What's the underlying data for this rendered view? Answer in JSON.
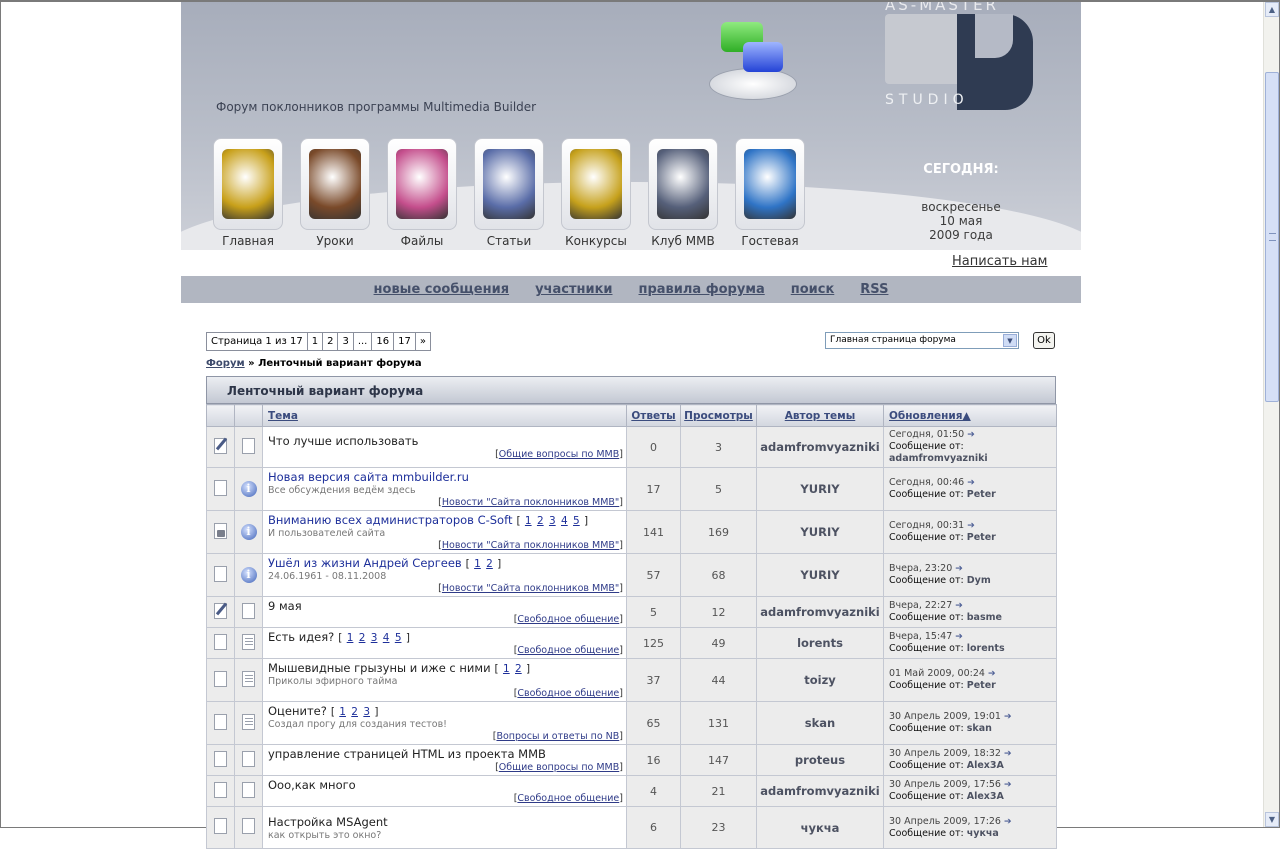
{
  "header": {
    "tagline": "Форум поклонников программы Multimedia Builder",
    "logo": {
      "top": "AS-MASTER",
      "bottom": "STUDIO"
    },
    "nav": [
      {
        "label": "Главная",
        "icon": "gold-cube-icon",
        "color": "#c8a01a"
      },
      {
        "label": "Уроки",
        "icon": "binders-icon",
        "color": "#7a4a2a"
      },
      {
        "label": "Файлы",
        "icon": "sack-icon",
        "color": "#c44e8c"
      },
      {
        "label": "Статьи",
        "icon": "webpage-icon",
        "color": "#5a6da8"
      },
      {
        "label": "Конкурсы",
        "icon": "trophy-icon",
        "color": "#c6a11c"
      },
      {
        "label": "Клуб MMB",
        "icon": "people-group-icon",
        "color": "#56607a"
      },
      {
        "label": "Гостевая",
        "icon": "quill-book-icon",
        "color": "#2f74c6"
      }
    ],
    "today_label": "СЕГОДНЯ:",
    "date": {
      "weekday": "воскресенье",
      "day": "10 мая",
      "year": "2009 года"
    }
  },
  "write_us": "Написать нам",
  "menu": [
    "новые сообщения",
    "участники",
    "правила форума",
    "поиск",
    "RSS"
  ],
  "pager": {
    "label": "Страница 1 из 17",
    "pages": [
      "1",
      "2",
      "3",
      "...",
      "16",
      "17",
      "»"
    ]
  },
  "jump": {
    "selected": "Главная страница форума",
    "ok": "Ok"
  },
  "breadcrumb": {
    "root": "Форум",
    "sep": " » ",
    "current": "Ленточный вариант форума"
  },
  "table": {
    "title": "Ленточный вариант форума",
    "columns": {
      "topic": "Тема",
      "replies": "Ответы",
      "views": "Просмотры",
      "author": "Автор темы",
      "updated": "Обновления▲"
    },
    "msg_from": "Сообщение от:",
    "rows": [
      {
        "icon1": "pen",
        "icon2": "doc",
        "title": "Что лучше использовать",
        "link": false,
        "subtitle": "",
        "pages": "",
        "category": "Общие вопросы по MMB",
        "replies": "0",
        "views": "3",
        "author": "adamfromvyazniki",
        "when": "Сегодня, 01:50",
        "who": "adamfromvyazniki"
      },
      {
        "icon1": "doc",
        "icon2": "info",
        "title": "Новая версия сайта mmbuilder.ru",
        "link": true,
        "subtitle": "Все обсуждения ведём здесь",
        "pages": "",
        "category": "Новости \"Сайта поклонников MMB\"",
        "replies": "17",
        "views": "5",
        "author": "YURIY",
        "when": "Сегодня, 00:46",
        "who": "Peter"
      },
      {
        "icon1": "lock",
        "icon2": "info",
        "title": "Вниманию всех администраторов C-Soft",
        "link": true,
        "subtitle": "И пользователей сайта",
        "pages": "1 2 3 4 5",
        "category": "Новости \"Сайта поклонников MMB\"",
        "replies": "141",
        "views": "169",
        "author": "YURIY",
        "when": "Сегодня, 00:31",
        "who": "Peter"
      },
      {
        "icon1": "doc",
        "icon2": "info",
        "title": "Ушёл из жизни Андрей Сергеев",
        "link": true,
        "subtitle": "24.06.1961 - 08.11.2008",
        "pages": "1 2",
        "category": "Новости \"Сайта поклонников MMB\"",
        "replies": "57",
        "views": "68",
        "author": "YURIY",
        "when": "Вчера, 23:20",
        "who": "Dym"
      },
      {
        "icon1": "pen",
        "icon2": "doc",
        "title": "9 мая",
        "link": false,
        "subtitle": "",
        "pages": "",
        "category": "Свободное общение",
        "replies": "5",
        "views": "12",
        "author": "adamfromvyazniki",
        "when": "Вчера, 22:27",
        "who": "basme"
      },
      {
        "icon1": "doc",
        "icon2": "lines",
        "title": "Есть идея?",
        "link": false,
        "subtitle": "",
        "pages": "1 2 3 4 5",
        "category": "Свободное общение",
        "replies": "125",
        "views": "49",
        "author": "lorents",
        "when": "Вчера, 15:47",
        "who": "lorents"
      },
      {
        "icon1": "doc",
        "icon2": "lines",
        "title": "Мышевидные грызуны и иже с ними",
        "link": false,
        "subtitle": "Приколы эфирного тайма",
        "pages": "1 2",
        "category": "Свободное общение",
        "replies": "37",
        "views": "44",
        "author": "toizy",
        "when": "01 Май 2009, 00:24",
        "who": "Peter"
      },
      {
        "icon1": "doc",
        "icon2": "lines",
        "title": "Оцените?",
        "link": false,
        "subtitle": "Создал прогу для создания тестов!",
        "pages": "1 2 3",
        "category": "Вопросы и ответы по NB",
        "replies": "65",
        "views": "131",
        "author": "skan",
        "when": "30 Апрель 2009, 19:01",
        "who": "skan"
      },
      {
        "icon1": "doc",
        "icon2": "doc",
        "title": "управление страницей HTML из проекта MMB",
        "link": false,
        "subtitle": "",
        "pages": "",
        "category": "Общие вопросы по MMB",
        "replies": "16",
        "views": "147",
        "author": "proteus",
        "when": "30 Апрель 2009, 18:32",
        "who": "Alex3A"
      },
      {
        "icon1": "doc",
        "icon2": "doc",
        "title": "Ооо,как много",
        "link": false,
        "subtitle": "",
        "pages": "",
        "category": "Свободное общение",
        "replies": "4",
        "views": "21",
        "author": "adamfromvyazniki",
        "when": "30 Апрель 2009, 17:56",
        "who": "Alex3A"
      },
      {
        "icon1": "doc",
        "icon2": "doc",
        "title": "Настройка MSAgent",
        "link": false,
        "subtitle": "как открыть это окно?",
        "pages": "",
        "category": "",
        "replies": "6",
        "views": "23",
        "author": "чукча",
        "when": "30 Апрель 2009, 17:26",
        "who": "чукча"
      }
    ]
  }
}
